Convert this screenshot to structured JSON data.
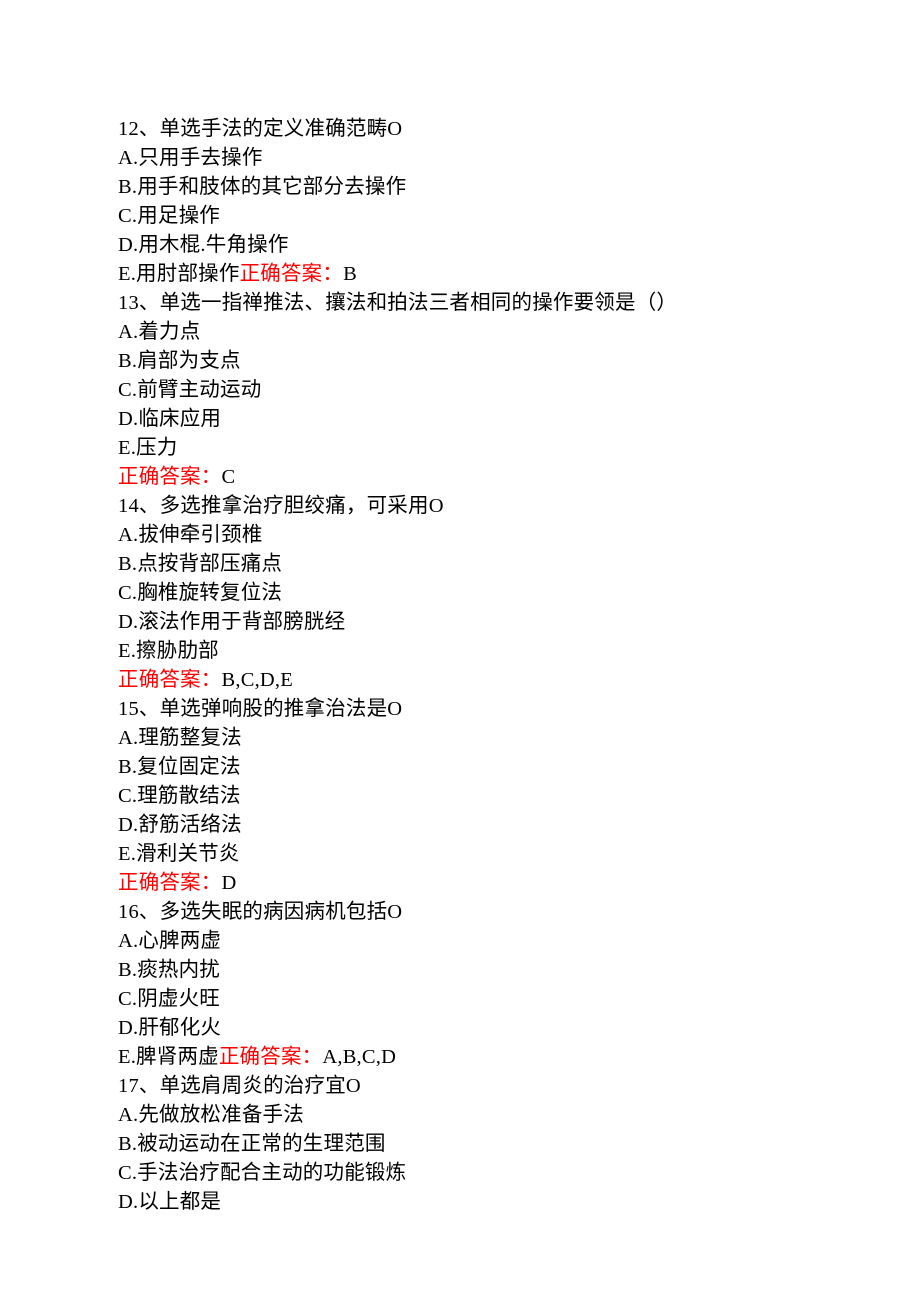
{
  "q12": {
    "stem": "12、单选手法的定义准确范畴O",
    "a": "A.只用手去操作",
    "b": "B.用手和肢体的其它部分去操作",
    "c": "C.用足操作",
    "d": "D.用木棍.牛角操作",
    "e_prefix": "E.用肘部操作",
    "ans_label": "正确答案：",
    "ans_value": "B"
  },
  "q13": {
    "stem": "13、单选一指禅推法、攘法和拍法三者相同的操作要领是（）",
    "a": "A.着力点",
    "b": "B.肩部为支点",
    "c": "C.前臂主动运动",
    "d": "D.临床应用",
    "e": "E.压力",
    "ans_label": "正确答案：",
    "ans_value": "C"
  },
  "q14": {
    "stem": "14、多选推拿治疗胆绞痛，可采用O",
    "a": "A.拔伸牵引颈椎",
    "b": "B.点按背部压痛点",
    "c": "C.胸椎旋转复位法",
    "d": "D.滚法作用于背部膀胱经",
    "e": "E.擦胁肋部",
    "ans_label": "正确答案：",
    "ans_value": "B,C,D,E"
  },
  "q15": {
    "stem": "15、单选弹响股的推拿治法是O",
    "a": "A.理筋整复法",
    "b": "B.复位固定法",
    "c": "C.理筋散结法",
    "d": "D.舒筋活络法",
    "e": "E.滑利关节炎",
    "ans_label": "正确答案：",
    "ans_value": "D"
  },
  "q16": {
    "stem": "16、多选失眠的病因病机包括O",
    "a": "A.心脾两虚",
    "b": "B.痰热内扰",
    "c": "C.阴虚火旺",
    "d": "D.肝郁化火",
    "e_prefix": "E.脾肾两虚",
    "ans_label": "正确答案：",
    "ans_value": "A,B,C,D"
  },
  "q17": {
    "stem": "17、单选肩周炎的治疗宜O",
    "a": "A.先做放松准备手法",
    "b": "B.被动运动在正常的生理范围",
    "c": "C.手法治疗配合主动的功能锻炼",
    "d": "D.以上都是"
  }
}
